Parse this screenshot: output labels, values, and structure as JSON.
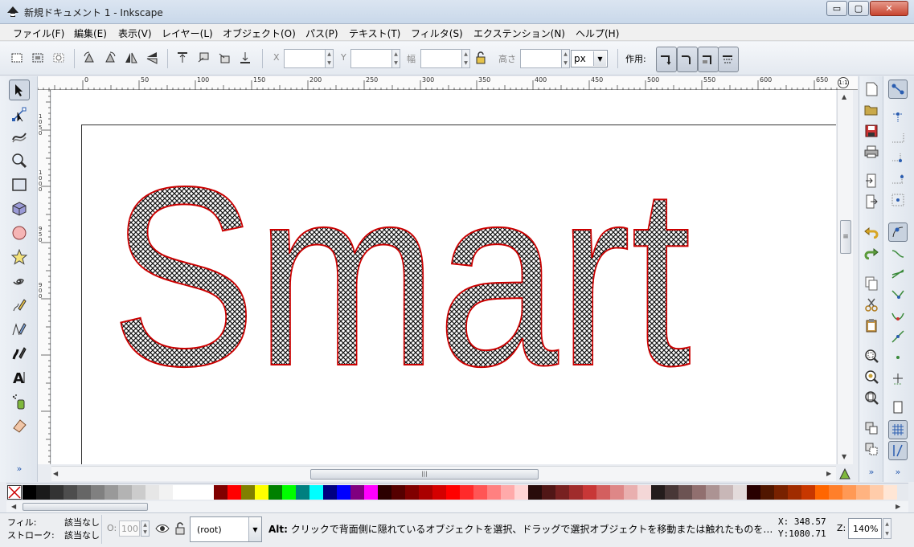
{
  "window": {
    "title": "新規ドキュメント 1 - Inkscape",
    "minimize": "▭",
    "maximize": "▢",
    "close": "✕"
  },
  "menu": [
    "ファイル(F)",
    "編集(E)",
    "表示(V)",
    "レイヤー(L)",
    "オブジェクト(O)",
    "パス(P)",
    "テキスト(T)",
    "フィルタ(S)",
    "エクステンション(N)",
    "ヘルプ(H)"
  ],
  "toolbar": {
    "x_label": "X",
    "y_label": "Y",
    "w_label": "幅",
    "h_label": "高さ",
    "unit": "px",
    "action_label": "作用:"
  },
  "ruler": {
    "top_ticks": [
      "0",
      "50",
      "100",
      "150",
      "200",
      "250",
      "300",
      "350",
      "400",
      "450",
      "500",
      "550",
      "600",
      "650"
    ],
    "left_ticks": [
      "1\n0\n5\n0",
      "1\n0\n0\n0",
      "9\n5\n0",
      "9\n0\n0"
    ]
  },
  "canvas": {
    "text": "Smart",
    "text_fill": "crosshatch-pattern",
    "text_stroke": "#cc0000"
  },
  "scroll": {
    "hthumb_grip": "|||",
    "vthumb_grip": "≡"
  },
  "palette": {
    "colors": [
      "#000000",
      "#1a1a1a",
      "#333333",
      "#4d4d4d",
      "#666666",
      "#808080",
      "#999999",
      "#b3b3b3",
      "#cccccc",
      "#e6e6e6",
      "#f2f2f2",
      "#ffffff",
      "#ffffff",
      "#ffffff",
      "#800000",
      "#ff0000",
      "#808000",
      "#ffff00",
      "#008000",
      "#00ff00",
      "#008080",
      "#00ffff",
      "#000080",
      "#0000ff",
      "#800080",
      "#ff00ff",
      "#2b0000",
      "#550000",
      "#800000",
      "#aa0000",
      "#d40000",
      "#ff0000",
      "#ff2a2a",
      "#ff5555",
      "#ff8080",
      "#ffaaaa",
      "#ffd5d5",
      "#280b0b",
      "#501616",
      "#782121",
      "#a02c2c",
      "#c83737",
      "#d35f5f",
      "#de8787",
      "#e9afaf",
      "#f4d7d7",
      "#241c1c",
      "#483737",
      "#6c5353",
      "#916f6f",
      "#ac9393",
      "#c8b7b7",
      "#e3dbdb",
      "#280000",
      "#501600",
      "#782100",
      "#a02c00",
      "#c83700",
      "#ff6600",
      "#ff7f2a",
      "#ff9955",
      "#ffb380",
      "#ffccaa",
      "#ffe6d5"
    ]
  },
  "status": {
    "fill_label": "フィル:",
    "fill_value": "該当なし",
    "stroke_label": "ストローク:",
    "stroke_value": "該当なし",
    "opacity_label": "O:",
    "opacity_value": "100",
    "layer": "(root)",
    "message_key": "Alt:",
    "message": " クリックで背面側に隠れているオブジェクトを選択、ドラッグで選択オブジェクトを移動または触れたものを…",
    "x": "X:  348.57",
    "y": "Y:1080.71",
    "zoom_label": "Z:",
    "zoom": "140%"
  }
}
